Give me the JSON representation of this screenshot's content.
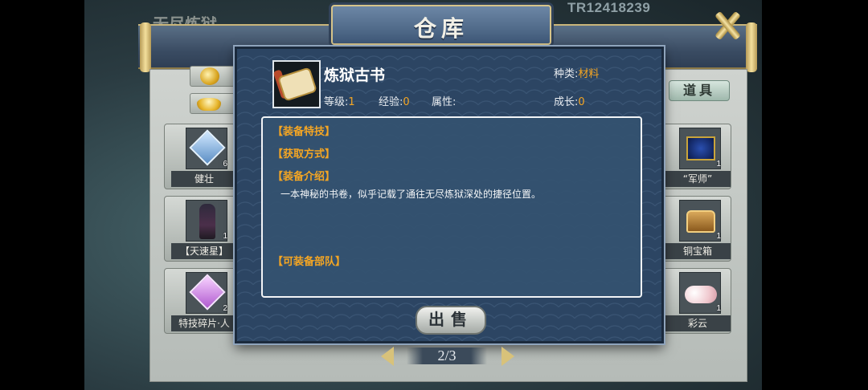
{
  "header": {
    "title": "仓库",
    "faded_title": "无尽炼狱",
    "tr_code": "TR12418239"
  },
  "tabs": {
    "tools_label": "道具"
  },
  "left_slots": [
    {
      "name": "健壮",
      "count": "6",
      "icon": "crystal-shard-icon"
    },
    {
      "name": "【天速星】",
      "count": "1",
      "icon": "warrior-portrait-icon"
    },
    {
      "name": "特技碎片·人",
      "count": "2",
      "icon": "pink-shard-icon"
    }
  ],
  "right_slots": [
    {
      "name": "“军师”",
      "count": "1",
      "icon": "strategist-scroll-icon"
    },
    {
      "name": "铜宝箱",
      "count": "1",
      "icon": "copper-chest-icon"
    },
    {
      "name": "彩云",
      "count": "1",
      "icon": "colored-cloud-icon"
    }
  ],
  "item": {
    "name": "炼狱古书",
    "icon": "ancient-book-scroll-icon",
    "type_label": "种类:",
    "type_value": "材料",
    "level_label": "等级:",
    "level_value": "1",
    "exp_label": "经验:",
    "exp_value": "0",
    "attr_label": "属性:",
    "growth_label": "成长:",
    "growth_value": "0"
  },
  "sections": {
    "skill": "【装备特技】",
    "obtain": "【获取方式】",
    "intro": "【装备介绍】",
    "intro_text": "一本神秘的书卷，似乎记载了通往无尽炼狱深处的捷径位置。",
    "troops": "【可装备部队】"
  },
  "actions": {
    "sell": "出售"
  },
  "pager": {
    "text": "2/3"
  },
  "colors": {
    "accent": "#f5a623",
    "dialog_bg": "#2c4563"
  }
}
